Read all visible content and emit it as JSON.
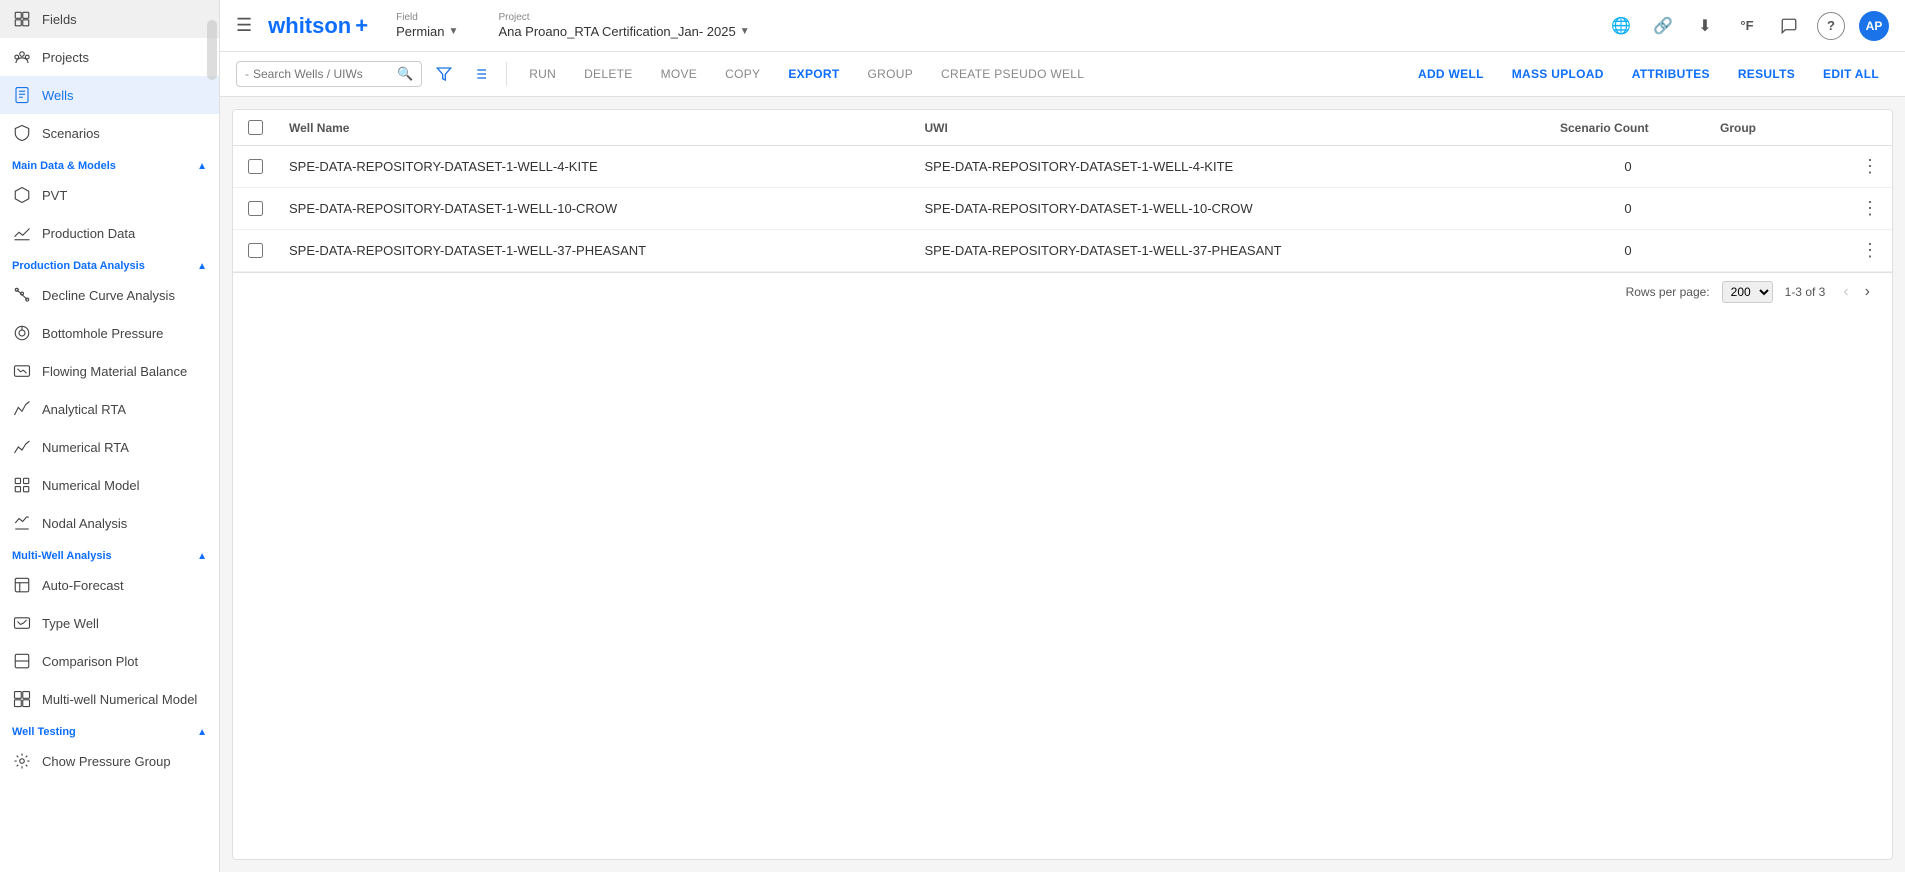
{
  "topbar": {
    "hamburger_label": "☰",
    "logo_text": "whitson",
    "logo_plus": "+",
    "field_label": "Field",
    "field_value": "Permian",
    "project_label": "Project",
    "project_value": "Ana Proano_RTA Certification_Jan- 2025",
    "icons": {
      "globe": "🌐",
      "link": "🔗",
      "download": "⬇",
      "temp": "°F",
      "chat": "💬",
      "help": "?",
      "avatar": "AP"
    }
  },
  "sidebar": {
    "items_top": [
      {
        "id": "fields",
        "label": "Fields",
        "icon": "grid"
      },
      {
        "id": "projects",
        "label": "Projects",
        "icon": "folder"
      },
      {
        "id": "wells",
        "label": "Wells",
        "icon": "wells",
        "active": true
      },
      {
        "id": "scenarios",
        "label": "Scenarios",
        "icon": "scenarios"
      }
    ],
    "sections": [
      {
        "id": "main-data-models",
        "label": "Main Data & Models",
        "expanded": true,
        "items": [
          {
            "id": "pvt",
            "label": "PVT",
            "icon": "pvt"
          },
          {
            "id": "production-data",
            "label": "Production Data",
            "icon": "production"
          }
        ]
      },
      {
        "id": "production-data-analysis",
        "label": "Production Data Analysis",
        "expanded": true,
        "items": [
          {
            "id": "decline-curve",
            "label": "Decline Curve Analysis",
            "icon": "decline"
          },
          {
            "id": "bottomhole",
            "label": "Bottomhole Pressure",
            "icon": "bottomhole"
          },
          {
            "id": "flowing-material",
            "label": "Flowing Material Balance",
            "icon": "flowing"
          },
          {
            "id": "analytical-rta",
            "label": "Analytical RTA",
            "icon": "analytical"
          },
          {
            "id": "numerical-rta",
            "label": "Numerical RTA",
            "icon": "numerical"
          },
          {
            "id": "numerical-model",
            "label": "Numerical Model",
            "icon": "nummodel"
          },
          {
            "id": "nodal-analysis",
            "label": "Nodal Analysis",
            "icon": "nodal"
          }
        ]
      },
      {
        "id": "multi-well-analysis",
        "label": "Multi-Well Analysis",
        "expanded": true,
        "items": [
          {
            "id": "auto-forecast",
            "label": "Auto-Forecast",
            "icon": "autoforecast"
          },
          {
            "id": "type-well",
            "label": "Type Well",
            "icon": "typewell"
          },
          {
            "id": "comparison-plot",
            "label": "Comparison Plot",
            "icon": "comparison"
          },
          {
            "id": "multi-numerical",
            "label": "Multi-well Numerical Model",
            "icon": "multinumerical"
          }
        ]
      },
      {
        "id": "well-testing",
        "label": "Well Testing",
        "expanded": true,
        "items": [
          {
            "id": "chow-pressure",
            "label": "Chow Pressure Group",
            "icon": "chow"
          }
        ]
      }
    ]
  },
  "toolbar": {
    "search_placeholder": "Search Wells / UIWs",
    "search_label": "-",
    "buttons": [
      {
        "id": "run",
        "label": "RUN",
        "active": false
      },
      {
        "id": "delete",
        "label": "DELETE",
        "active": false
      },
      {
        "id": "move",
        "label": "MOVE",
        "active": false
      },
      {
        "id": "copy",
        "label": "COPY",
        "active": false
      },
      {
        "id": "export",
        "label": "EXPORT",
        "active": true
      },
      {
        "id": "group",
        "label": "GROUP",
        "active": false
      },
      {
        "id": "create-pseudo",
        "label": "CREATE PSEUDO WELL",
        "active": false
      },
      {
        "id": "add-well",
        "label": "ADD WELL",
        "active": true
      },
      {
        "id": "mass-upload",
        "label": "MASS UPLOAD",
        "active": true
      },
      {
        "id": "attributes",
        "label": "ATTRIBUTES",
        "active": true
      },
      {
        "id": "results",
        "label": "RESULTS",
        "active": true
      },
      {
        "id": "edit-all",
        "label": "EDIT ALL",
        "active": true
      }
    ]
  },
  "table": {
    "columns": [
      {
        "id": "checkbox",
        "label": ""
      },
      {
        "id": "well-name",
        "label": "Well Name"
      },
      {
        "id": "uwi",
        "label": "UWI"
      },
      {
        "id": "scenario-count",
        "label": "Scenario Count"
      },
      {
        "id": "group",
        "label": "Group"
      },
      {
        "id": "actions",
        "label": ""
      }
    ],
    "rows": [
      {
        "id": "row-1",
        "well_name": "SPE-DATA-REPOSITORY-DATASET-1-WELL-4-KITE",
        "uwi": "SPE-DATA-REPOSITORY-DATASET-1-WELL-4-KITE",
        "scenario_count": "0",
        "group": ""
      },
      {
        "id": "row-2",
        "well_name": "SPE-DATA-REPOSITORY-DATASET-1-WELL-10-CROW",
        "uwi": "SPE-DATA-REPOSITORY-DATASET-1-WELL-10-CROW",
        "scenario_count": "0",
        "group": ""
      },
      {
        "id": "row-3",
        "well_name": "SPE-DATA-REPOSITORY-DATASET-1-WELL-37-PHEASANT",
        "uwi": "SPE-DATA-REPOSITORY-DATASET-1-WELL-37-PHEASANT",
        "scenario_count": "0",
        "group": ""
      }
    ]
  },
  "pagination": {
    "rows_per_page_label": "Rows per page:",
    "rows_per_page_value": "200",
    "range_label": "1-3 of 3"
  }
}
